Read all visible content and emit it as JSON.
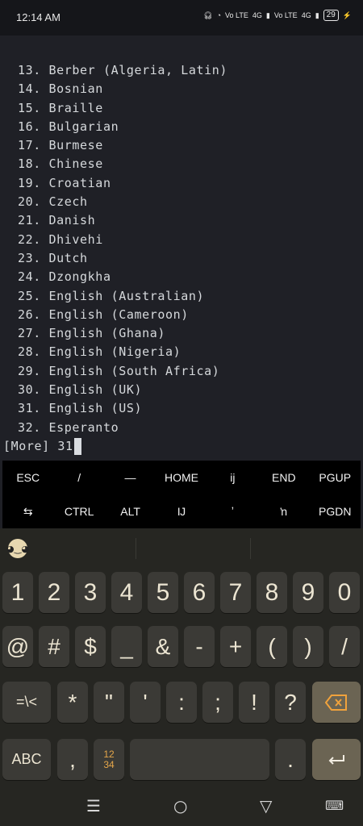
{
  "status_bar": {
    "time": "12:14 AM",
    "indicators": [
      "headset-icon",
      "wifi-icon",
      "Vo LTE",
      "4G",
      "Vo LTE",
      "4G"
    ],
    "battery": "29"
  },
  "terminal": {
    "lines": [
      "13. Berber (Algeria, Latin)",
      "14. Bosnian",
      "15. Braille",
      "16. Bulgarian",
      "17. Burmese",
      "18. Chinese",
      "19. Croatian",
      "20. Czech",
      "21. Danish",
      "22. Dhivehi",
      "23. Dutch",
      "24. Dzongkha",
      "25. English (Australian)",
      "26. English (Cameroon)",
      "27. English (Ghana)",
      "28. English (Nigeria)",
      "29. English (South Africa)",
      "30. English (UK)",
      "31. English (US)",
      "32. Esperanto"
    ],
    "prompt": "[More] 31"
  },
  "extra_keys": {
    "row1": [
      "ESC",
      "/",
      "—",
      "HOME",
      "ĳ",
      "END",
      "PGUP"
    ],
    "row2": [
      "⇆",
      "CTRL",
      "ALT",
      "Ĳ",
      "ʼ",
      "ŉ",
      "PGDN"
    ]
  },
  "keyboard": {
    "row1": [
      "1",
      "2",
      "3",
      "4",
      "5",
      "6",
      "7",
      "8",
      "9",
      "0"
    ],
    "row2": [
      "@",
      "#",
      "$",
      "_",
      "&",
      "-",
      "+",
      "(",
      ")",
      "/"
    ],
    "row3": [
      "=\\<",
      "*",
      "\"",
      "'",
      ":",
      ";",
      "!",
      "?"
    ],
    "abc": "ABC",
    "comma": ",",
    "numpad_top": "12",
    "numpad_bottom": "34",
    "period": "."
  }
}
